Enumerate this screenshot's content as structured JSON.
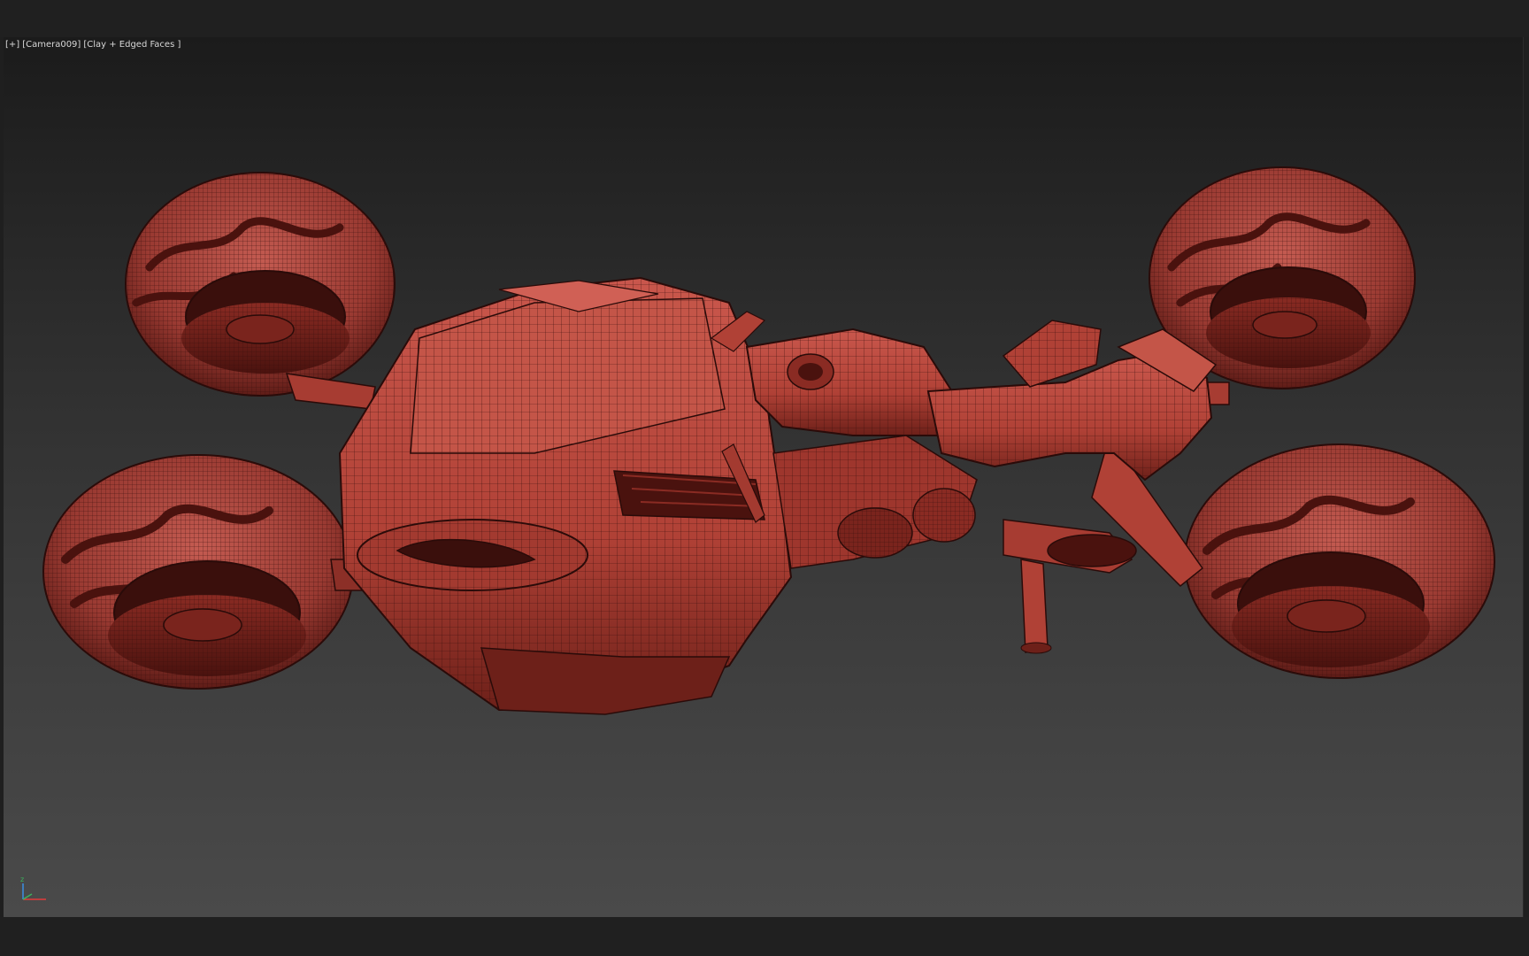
{
  "viewport": {
    "menu_label": "[+]",
    "camera_label": "[Camera009]",
    "shading_label": "[Clay + Edged Faces ]"
  },
  "gizmo": {
    "z_label": "z",
    "x_color": "#e23b3b",
    "y_color": "#3b8fe2",
    "z_color": "#3bb35c"
  },
  "scene": {
    "object": "hover-bike",
    "material_color": "#b8483f",
    "wire_color": "#2a0b09"
  }
}
